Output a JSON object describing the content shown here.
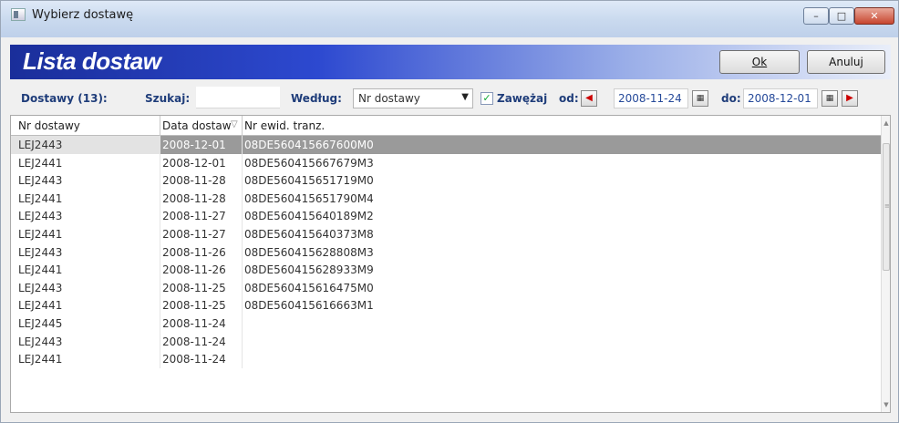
{
  "window": {
    "title": "Wybierz dostawę",
    "controls": {
      "minimize": "–",
      "maximize": "□",
      "close": "✕"
    }
  },
  "header": {
    "title": "Lista dostaw",
    "ok_label": "Ok",
    "cancel_label": "Anuluj"
  },
  "filter": {
    "count_label": "Dostawy (13):",
    "search_label": "Szukaj:",
    "search_value": "",
    "by_label": "Według:",
    "by_value": "Nr dostawy",
    "narrow_label": "Zawężaj",
    "narrow_checked": true,
    "from_label": "od:",
    "from_value": "2008-11-24",
    "to_label": "do:",
    "to_value": "2008-12-01"
  },
  "grid": {
    "columns": [
      "Nr dostawy",
      "Data dostaw",
      "Nr ewid. tranz."
    ],
    "rows": [
      [
        "LEJ2443",
        "2008-12-01",
        "08DE560415667600M0"
      ],
      [
        "LEJ2441",
        "2008-12-01",
        "08DE560415667679M3"
      ],
      [
        "LEJ2443",
        "2008-11-28",
        "08DE560415651719M0"
      ],
      [
        "LEJ2441",
        "2008-11-28",
        "08DE560415651790M4"
      ],
      [
        "LEJ2443",
        "2008-11-27",
        "08DE560415640189M2"
      ],
      [
        "LEJ2441",
        "2008-11-27",
        "08DE560415640373M8"
      ],
      [
        "LEJ2443",
        "2008-11-26",
        "08DE560415628808M3"
      ],
      [
        "LEJ2441",
        "2008-11-26",
        "08DE560415628933M9"
      ],
      [
        "LEJ2443",
        "2008-11-25",
        "08DE560415616475M0"
      ],
      [
        "LEJ2441",
        "2008-11-25",
        "08DE560415616663M1"
      ],
      [
        "LEJ2445",
        "2008-11-24",
        ""
      ],
      [
        "LEJ2443",
        "2008-11-24",
        ""
      ],
      [
        "LEJ2441",
        "2008-11-24",
        ""
      ]
    ],
    "selected_row": 0
  },
  "colors": {
    "banner_dark": "#1a2e9a",
    "label_blue": "#1f3d7a",
    "selected_row": "#9a9a9a",
    "nav_arrow": "#cc0000"
  },
  "icons": {
    "app": "window-app-icon",
    "prev": "◀",
    "next": "▶",
    "calendar": "▦",
    "dropdown": "▼",
    "check": "✓",
    "sort": "▽"
  }
}
